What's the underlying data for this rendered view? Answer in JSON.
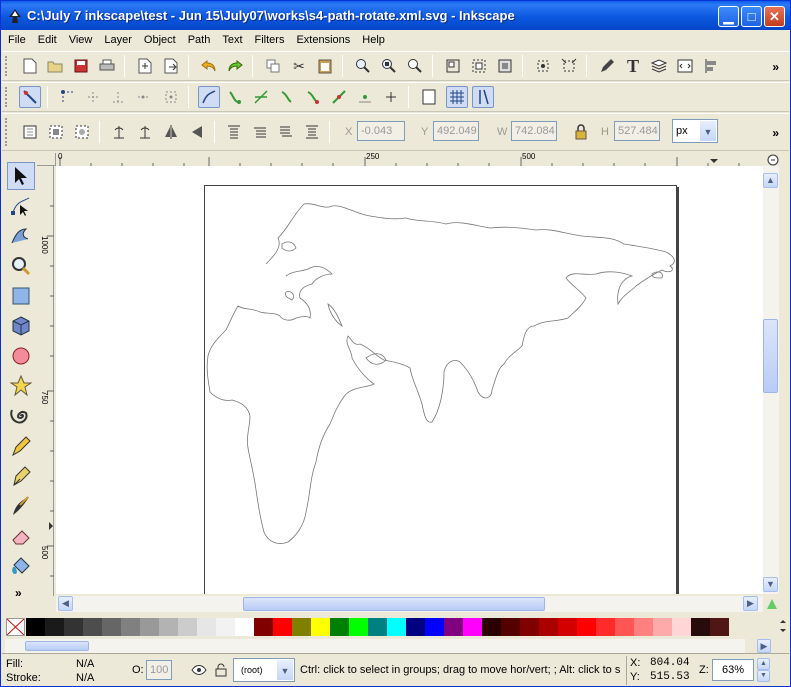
{
  "window": {
    "title": "C:\\July 7 inkscape\\test - Jun 15\\July07\\works\\s4-path-rotate.xml.svg - Inkscape"
  },
  "menu": [
    "File",
    "Edit",
    "View",
    "Layer",
    "Object",
    "Path",
    "Text",
    "Filters",
    "Extensions",
    "Help"
  ],
  "select_bar": {
    "x_label": "X",
    "x": "-0.043",
    "y_label": "Y",
    "y": "492.049",
    "w_label": "W",
    "w": "742.084",
    "h_label": "H",
    "h": "527.484",
    "unit": "px"
  },
  "ruler": {
    "h_ticks": [
      "0",
      "250",
      "500"
    ],
    "v_ticks": [
      "1000",
      "750",
      "500"
    ]
  },
  "palette": {
    "colors": [
      "#000000",
      "#1a1a1a",
      "#333333",
      "#4d4d4d",
      "#666666",
      "#808080",
      "#999999",
      "#b3b3b3",
      "#cccccc",
      "#e6e6e6",
      "#f2f2f2",
      "#ffffff",
      "#800000",
      "#ff0000",
      "#808000",
      "#ffff00",
      "#008000",
      "#00ff00",
      "#008080",
      "#00ffff",
      "#000080",
      "#0000ff",
      "#800080",
      "#ff00ff",
      "#2b0000",
      "#550000",
      "#800000",
      "#aa0000",
      "#d40000",
      "#ff0000",
      "#ff2a2a",
      "#ff5555",
      "#ff8080",
      "#ffaaaa",
      "#ffd5d5",
      "#280b0b",
      "#501616"
    ]
  },
  "status": {
    "fill_label": "Fill:",
    "fill_value": "N/A",
    "stroke_label": "Stroke:",
    "stroke_value": "N/A",
    "opacity_label": "O:",
    "opacity_value": "100",
    "layer": "(root)",
    "message": "Ctrl: click to select in groups; drag to move hor/vert; ; Alt: click to s",
    "x_label": "X:",
    "x_value": "804.04",
    "y_label": "Y:",
    "y_value": "515.53",
    "zoom_label": "Z:",
    "zoom_value": "63%"
  },
  "ui": {
    "overflow": "»",
    "more": "⋮"
  }
}
